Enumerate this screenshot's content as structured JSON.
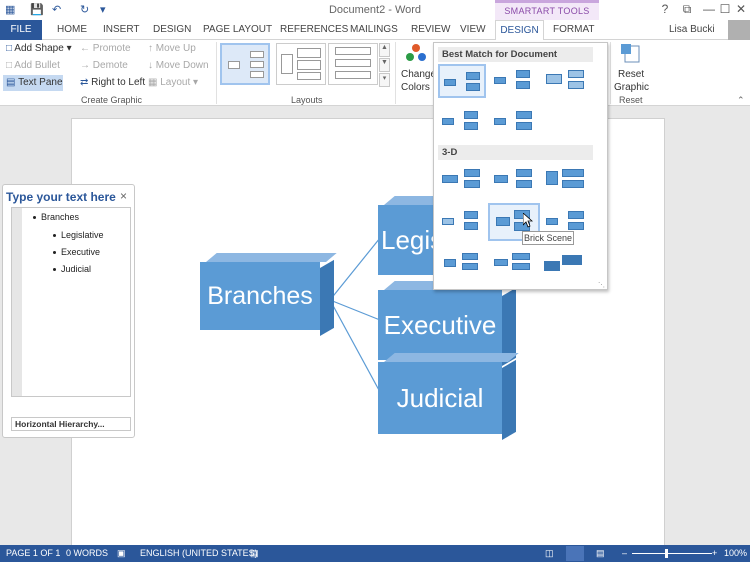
{
  "window": {
    "title": "Document2 - Word",
    "contextual_band": "SMARTART TOOLS",
    "user": "Lisa Bucki",
    "controls": {
      "help": "?",
      "restore": "⧉",
      "minimize": "—",
      "maximize": "☐",
      "close": "✕"
    }
  },
  "tabs": {
    "file": "FILE",
    "home": "HOME",
    "insert": "INSERT",
    "design": "DESIGN",
    "page_layout": "PAGE LAYOUT",
    "references": "REFERENCES",
    "mailings": "MAILINGS",
    "review": "REVIEW",
    "view": "VIEW",
    "smartart_design": "DESIGN",
    "smartart_format": "FORMAT"
  },
  "ribbon": {
    "create_graphic": {
      "add_shape": "Add Shape",
      "add_bullet": "Add Bullet",
      "text_pane": "Text Pane",
      "promote": "Promote",
      "demote": "Demote",
      "right_to_left": "Right to Left",
      "move_up": "Move Up",
      "move_down": "Move Down",
      "layout": "Layout",
      "group_label": "Create Graphic"
    },
    "layouts_label": "Layouts",
    "change_colors_line1": "Change",
    "change_colors_line2": "Colors",
    "reset_graphic_line1": "Reset",
    "reset_graphic_line2": "Graphic",
    "reset_label": "Reset"
  },
  "gallery": {
    "header_best": "Best Match for Document",
    "header_3d": "3-D",
    "tooltip": "Brick Scene"
  },
  "text_pane": {
    "title": "Type your text here",
    "close": "×",
    "items": [
      "Branches",
      "Legislative",
      "Executive",
      "Judicial"
    ],
    "footer": "Horizontal Hierarchy..."
  },
  "diagram": {
    "root": "Branches",
    "children": [
      "Legislative",
      "Executive",
      "Judicial"
    ],
    "visible_child_1": "Legis"
  },
  "status": {
    "page": "PAGE 1 OF 1",
    "words": "0 WORDS",
    "language": "ENGLISH (UNITED STATES)",
    "zoom": "100%",
    "zoom_minus": "–",
    "zoom_plus": "+"
  },
  "icons": [
    "word-icon",
    "save-icon",
    "undo-icon",
    "redo-icon",
    "customize-icon",
    "change-colors-icon",
    "reset-graphic-icon",
    "proofing-icon",
    "macro-icon",
    "read-mode-icon",
    "print-layout-icon",
    "web-layout-icon",
    "cursor-icon"
  ],
  "colors": {
    "accent": "#2b579a",
    "smartart_box": "#5b9bd5",
    "smartart_band": "#f3e8f8",
    "selection": "#c5d9f1"
  }
}
